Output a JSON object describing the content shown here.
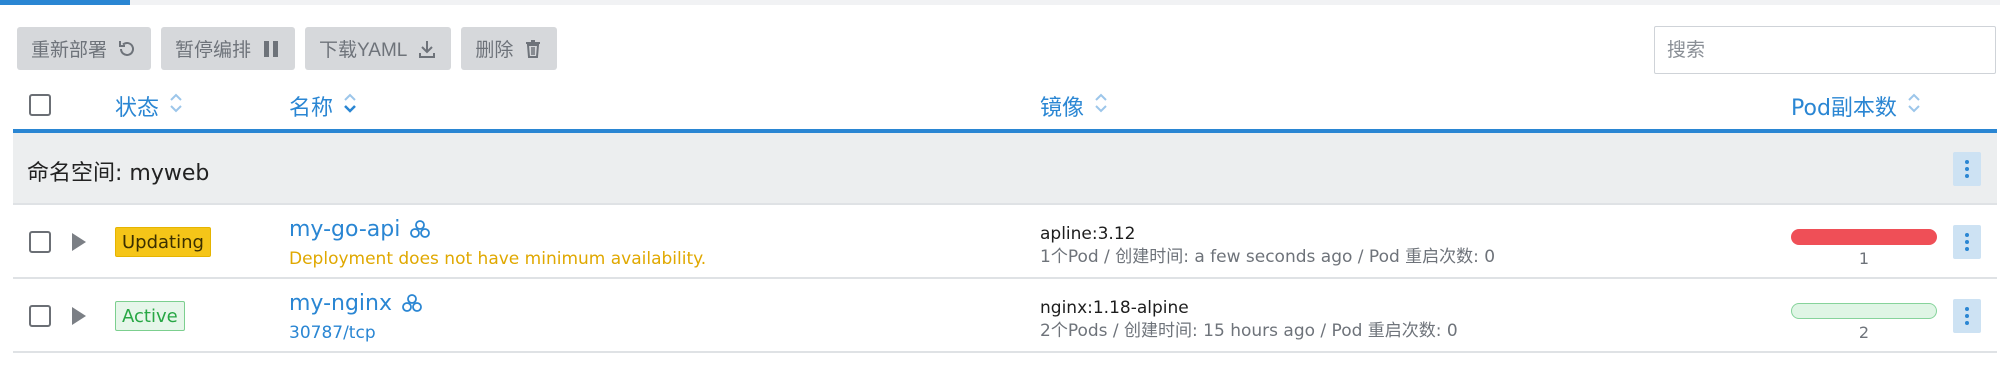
{
  "toolbar": {
    "redeploy_label": "重新部署",
    "pause_label": "暂停编排",
    "download_label": "下载YAML",
    "delete_label": "删除"
  },
  "search": {
    "placeholder": "搜索",
    "value": ""
  },
  "table": {
    "headers": {
      "state": "状态",
      "name": "名称",
      "image": "镜像",
      "pods": "Pod副本数"
    },
    "group": {
      "label": "命名空间: myweb"
    },
    "rows": [
      {
        "state": "Updating",
        "name": "my-go-api",
        "subtext": "Deployment does not have minimum availability.",
        "image": "apline:3.12",
        "image_detail": "1个Pod / 创建时间: a few seconds ago / Pod 重启次数: 0",
        "pod_count": "1",
        "pod_status_color": "#ef4f57"
      },
      {
        "state": "Active",
        "name": "my-nginx",
        "subtext": "30787/tcp",
        "image": "nginx:1.18-alpine",
        "image_detail": "2个Pods / 创建时间: 15 hours ago / Pod 重启次数: 0",
        "pod_count": "2",
        "pod_status_color": "#dff5e5"
      }
    ]
  },
  "colors": {
    "accent": "#2a86d3",
    "warning": "#f5c518",
    "success": "#28a745",
    "danger": "#ef4f57"
  }
}
